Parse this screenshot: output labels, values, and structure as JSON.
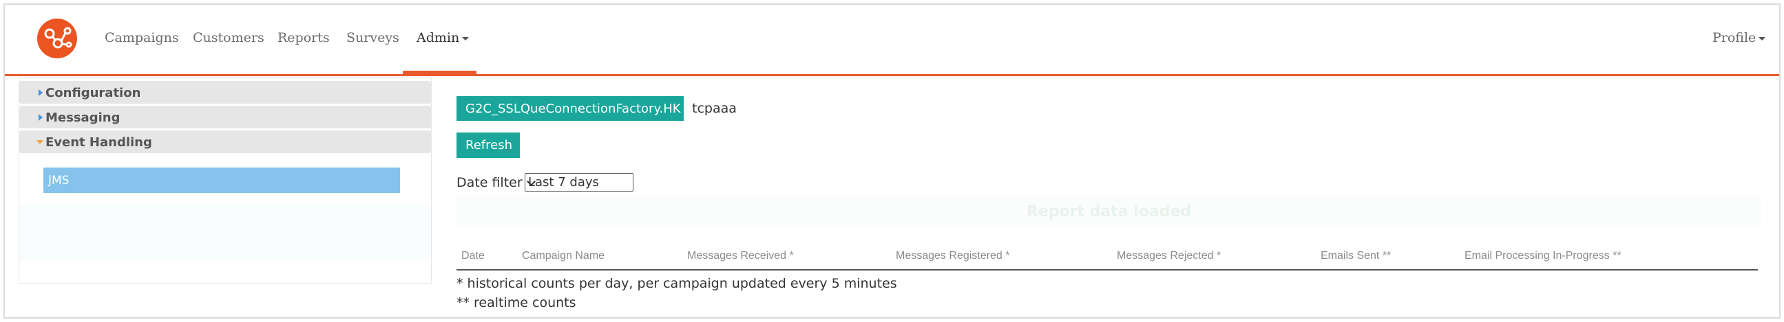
{
  "nav": {
    "links": [
      "Campaigns",
      "Customers",
      "Reports",
      "Surveys"
    ],
    "admin": "Admin",
    "profile": "Profile"
  },
  "sidebar": {
    "sections": [
      "Configuration",
      "Messaging",
      "Event Handling"
    ],
    "items": [
      "JMS"
    ]
  },
  "main": {
    "connection_button": "G2C_SSLQueConnectionFactory.HK",
    "connection_name": "tcpaaa",
    "refresh_label": "Refresh",
    "date_filter_label": "Date filter",
    "date_filter_value": "Last 7 days",
    "status": "Report data loaded",
    "table": {
      "headers": [
        "Date",
        "Campaign Name",
        "Messages Received *",
        "Messages Registered *",
        "Messages Rejected *",
        "Emails Sent **",
        "Email Processing In-Progress **"
      ],
      "rows": []
    },
    "footnotes": [
      "* historical counts per day, per campaign updated every 5 minutes",
      "** realtime counts"
    ]
  },
  "colors": {
    "accent": "#e9592b",
    "teal": "#1aa69b",
    "selected": "#85c3ec"
  }
}
